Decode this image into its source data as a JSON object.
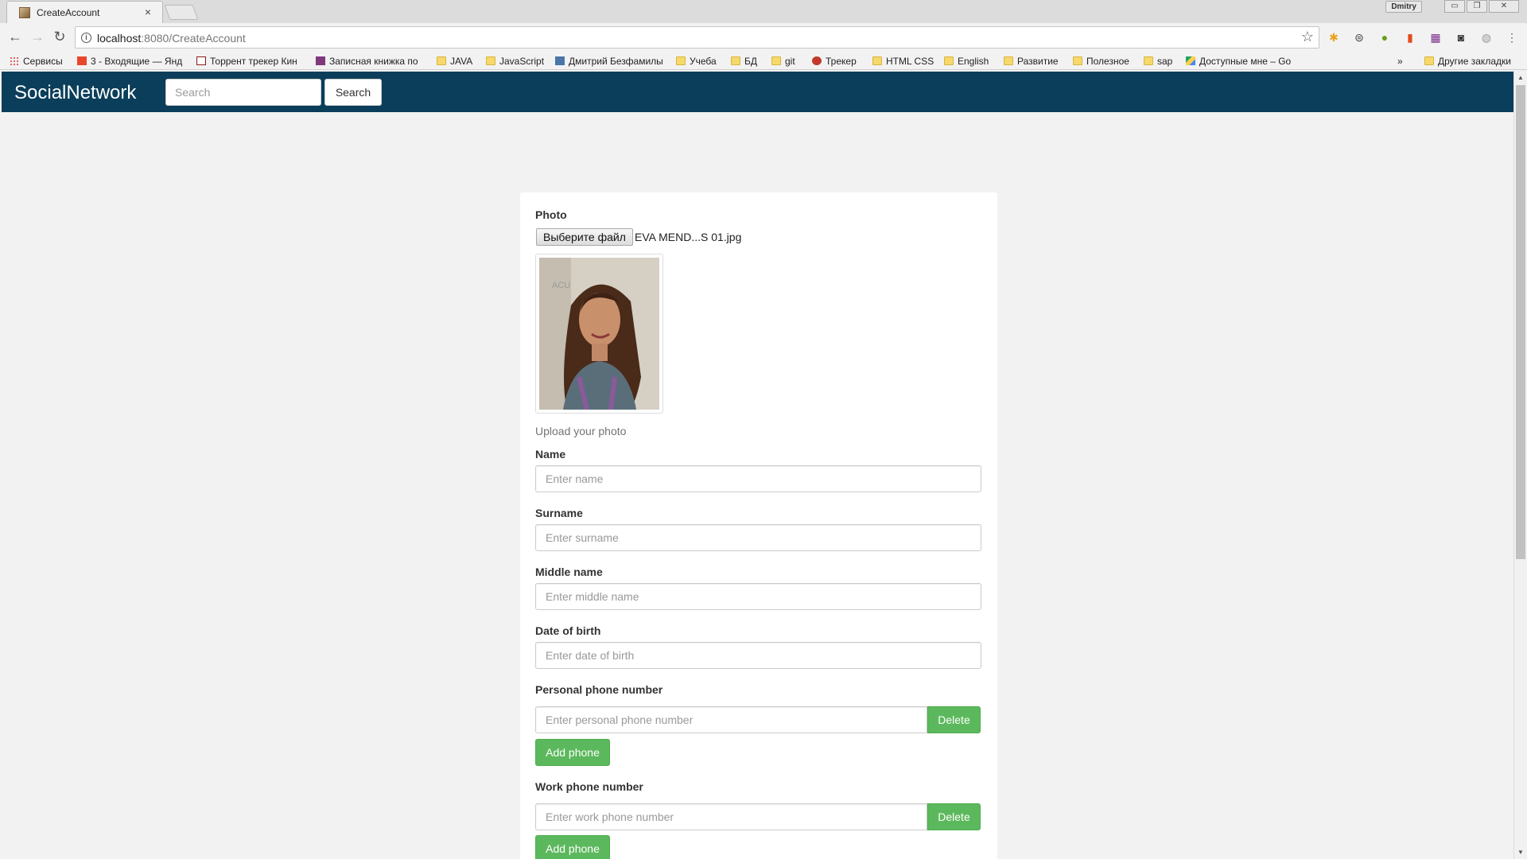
{
  "browser": {
    "tab_title": "CreateAccount",
    "tab_close": "×",
    "user_name": "Dmitry",
    "url_host": "localhost",
    "url_path": ":8080/CreateAccount",
    "bookmarks": [
      {
        "label": "Сервисы",
        "icon": "apps-icon"
      },
      {
        "label": "3 - Входящие — Янд",
        "icon": "mail-icon"
      },
      {
        "label": "Торрент трекер Кин",
        "icon": "kinozal-icon"
      },
      {
        "label": "Записная книжка по",
        "icon": "onenote-icon"
      },
      {
        "label": "JAVA",
        "icon": "folder-icon"
      },
      {
        "label": "JavaScript",
        "icon": "folder-icon"
      },
      {
        "label": "Дмитрий Безфамилы",
        "icon": "vk-icon"
      },
      {
        "label": "Учеба",
        "icon": "folder-icon"
      },
      {
        "label": "БД",
        "icon": "folder-icon"
      },
      {
        "label": "git",
        "icon": "folder-icon"
      },
      {
        "label": "Трекер",
        "icon": "tracker-icon"
      },
      {
        "label": "HTML CSS",
        "icon": "folder-icon"
      },
      {
        "label": "English",
        "icon": "folder-icon"
      },
      {
        "label": "Развитие",
        "icon": "folder-icon"
      },
      {
        "label": "Полезное",
        "icon": "folder-icon"
      },
      {
        "label": "sap",
        "icon": "folder-icon"
      },
      {
        "label": "Доступные мне – Go",
        "icon": "drive-icon"
      }
    ],
    "bookmarks_overflow": "»",
    "other_bookmarks": "Другие закладки"
  },
  "navbar": {
    "brand": "SocialNetwork",
    "search_placeholder": "Search",
    "search_button": "Search"
  },
  "form": {
    "photo_label": "Photo",
    "file_button": "Выберите файл",
    "file_name": "EVA MEND...S 01.jpg",
    "photo_help": "Upload your photo",
    "name_label": "Name",
    "name_placeholder": "Enter name",
    "surname_label": "Surname",
    "surname_placeholder": "Enter surname",
    "middle_label": "Middle name",
    "middle_placeholder": "Enter middle name",
    "dob_label": "Date of birth",
    "dob_placeholder": "Enter date of birth",
    "personal_phone_label": "Personal phone number",
    "personal_phone_placeholder": "Enter personal phone number",
    "work_phone_label": "Work phone number",
    "work_phone_placeholder": "Enter work phone number",
    "delete_button": "Delete",
    "add_phone_button": "Add phone"
  },
  "colors": {
    "navbar": "#0b3e5a",
    "success": "#5cb85c",
    "page_background": "#f2f2f2"
  }
}
